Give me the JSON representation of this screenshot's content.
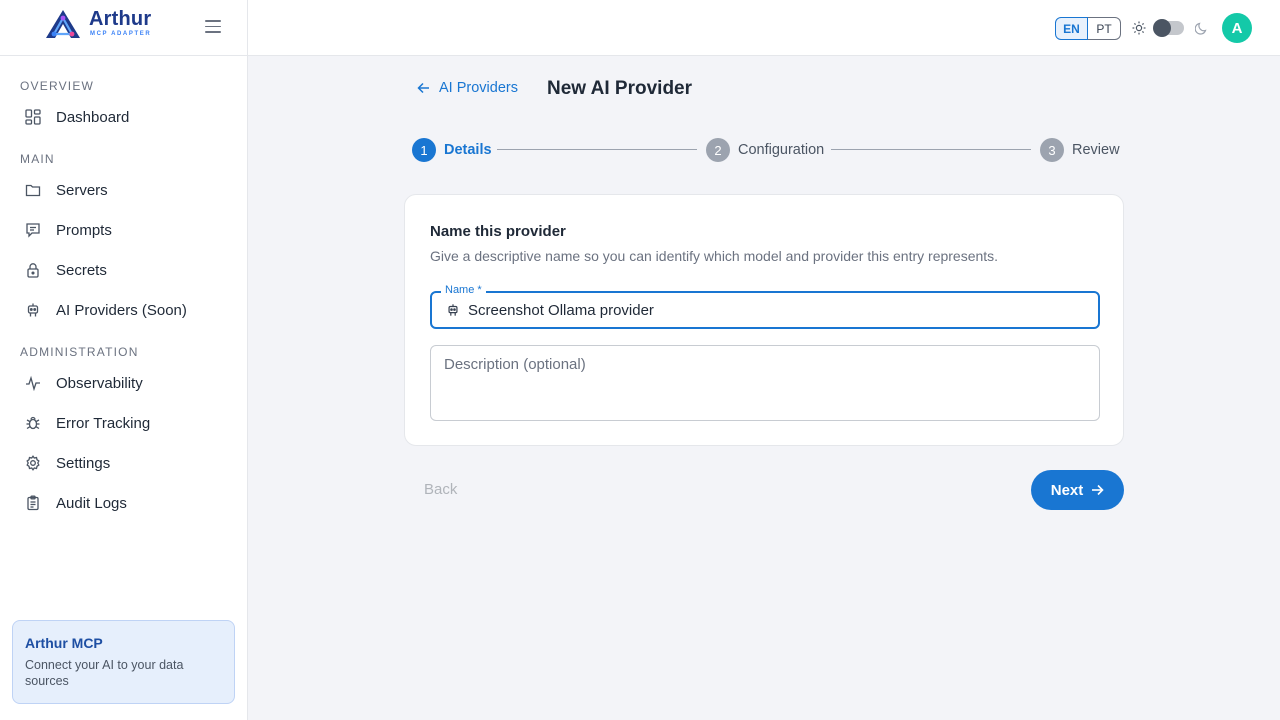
{
  "brand": {
    "name": "Arthur",
    "subtitle": "MCP ADAPTER"
  },
  "sidebar": {
    "sections": [
      {
        "title": "OVERVIEW"
      },
      {
        "title": "MAIN"
      },
      {
        "title": "ADMINISTRATION"
      }
    ],
    "items": [
      {
        "label": "Dashboard",
        "icon": "dashboard-icon"
      },
      {
        "label": "Servers",
        "icon": "folder-icon"
      },
      {
        "label": "Prompts",
        "icon": "chat-icon"
      },
      {
        "label": "Secrets",
        "icon": "lock-icon"
      },
      {
        "label": "AI Providers (Soon)",
        "icon": "robot-icon"
      },
      {
        "label": "Observability",
        "icon": "pulse-icon"
      },
      {
        "label": "Error Tracking",
        "icon": "bug-icon"
      },
      {
        "label": "Settings",
        "icon": "gear-icon"
      },
      {
        "label": "Audit Logs",
        "icon": "clipboard-icon"
      }
    ],
    "card": {
      "title": "Arthur MCP",
      "description": "Connect your AI to your data sources"
    }
  },
  "topbar": {
    "languages": [
      "EN",
      "PT"
    ],
    "selected_language": "EN",
    "avatar_initial": "A"
  },
  "page": {
    "back_link": "AI Providers",
    "title": "New AI Provider"
  },
  "stepper": {
    "active_step": 1,
    "steps": [
      {
        "number": "1",
        "label": "Details"
      },
      {
        "number": "2",
        "label": "Configuration"
      },
      {
        "number": "3",
        "label": "Review"
      }
    ]
  },
  "form": {
    "title": "Name this provider",
    "description": "Give a descriptive name so you can identify which model and provider this entry represents.",
    "name_label": "Name *",
    "name_value": "Screenshot Ollama provider",
    "description_placeholder": "Description (optional)",
    "description_value": ""
  },
  "actions": {
    "back_label": "Back",
    "next_label": "Next"
  },
  "colors": {
    "primary": "#1976d2",
    "brand": "#1e3a8a",
    "avatar": "#14c9a8",
    "background": "#f3f4f8"
  }
}
